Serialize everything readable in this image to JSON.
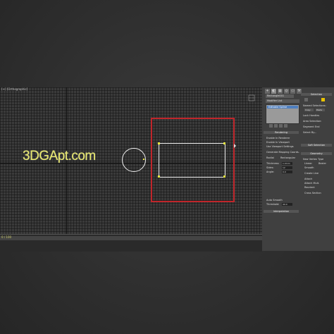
{
  "viewport": {
    "label": "[+] [Orthographic]",
    "watermark": "3DGApt.com"
  },
  "timeline": {
    "label": "0 / 100"
  },
  "command_panel": {
    "tabs": [
      "+",
      "◐",
      "▦",
      "◎",
      "▭",
      "⚒"
    ],
    "object_name": "Rectangle001",
    "modifier_list": "Modifier List",
    "stack_items": [
      "Editable Spline"
    ],
    "selection": {
      "title": "Selection",
      "named_sel": "Named Selections:",
      "copy": "Copy",
      "paste": "Paste",
      "lock_handles": "Lock Handles",
      "area_selection": "Area Selection:",
      "segment_end": "Segment End",
      "select_by": "Select By..."
    },
    "soft_selection": {
      "title": "Soft Selection"
    },
    "geometry": {
      "title": "Geometry",
      "new_vertex_type": "New Vertex Type",
      "linear": "Linear",
      "smooth": "Smooth",
      "bezier": "Bezier",
      "create_line": "Create Line",
      "attach": "Attach",
      "attach_mult": "Attach Mult.",
      "reorient": "Reorient",
      "cross_section": "Cross Section"
    },
    "rendering": {
      "title": "Rendering",
      "enable_render": "Enable In Renderer",
      "enable_viewport": "Enable In Viewport",
      "use_viewport": "Use Viewport Settings",
      "gen_mapping": "Generate Mapping Coords.",
      "radial": "Radial",
      "rectangular": "Rectangular",
      "thickness_label": "Thickness:",
      "thickness": "1.0mm",
      "sides_label": "Sides:",
      "sides": "12",
      "angle_label": "Angle:",
      "angle": "0.0",
      "auto_smooth": "Auto Smooth",
      "threshold_label": "Threshold:",
      "threshold": "40.0"
    },
    "interpolation": {
      "title": "Interpolation"
    }
  }
}
